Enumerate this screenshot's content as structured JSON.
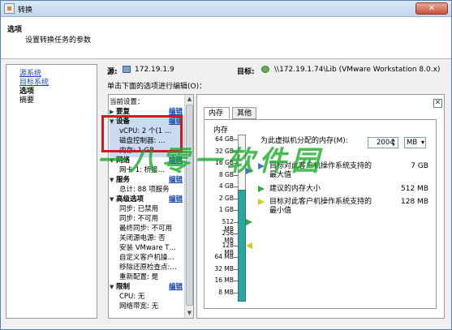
{
  "window": {
    "title": "转换",
    "close_glyph": "✕"
  },
  "header": {
    "title": "选项",
    "subtitle": "设置转换任务的参数"
  },
  "nav": {
    "items": [
      "源系统",
      "目标系统",
      "选项",
      "摘要"
    ]
  },
  "source": {
    "label": "源:",
    "value": "172.19.1.9"
  },
  "destination": {
    "label": "目标:",
    "value": "\\\\172.19.1.74\\Lib (VMware Workstation 8.0.x)"
  },
  "instruction": "单击下面的选项进行编辑(O)：",
  "settings": {
    "heading": "当前设置：",
    "edit_label": "编辑",
    "rows": [
      {
        "kind": "section",
        "text": "要复",
        "edit": true,
        "expanded": false
      },
      {
        "kind": "section",
        "text": "设备",
        "edit": true,
        "expanded": true
      },
      {
        "kind": "item",
        "text": "vCPU: 2 个(1 …"
      },
      {
        "kind": "item",
        "text": "磁盘控制器: …"
      },
      {
        "kind": "item",
        "text": "内存: 1 GB"
      },
      {
        "kind": "section",
        "text": "网络",
        "edit": true,
        "expanded": true
      },
      {
        "kind": "item",
        "text": "网卡 1: 桥接…"
      },
      {
        "kind": "section",
        "text": "服务",
        "edit": true,
        "expanded": true
      },
      {
        "kind": "item",
        "text": "总计: 88 项服务"
      },
      {
        "kind": "section",
        "text": "高级选项",
        "edit": true,
        "expanded": true
      },
      {
        "kind": "item",
        "text": "同步: 已禁用"
      },
      {
        "kind": "item",
        "text": "同步: 不可用"
      },
      {
        "kind": "item",
        "text": "最终同步: 不可用"
      },
      {
        "kind": "item",
        "text": "关闭源电源: 否"
      },
      {
        "kind": "item",
        "text": "安装 VMware T…"
      },
      {
        "kind": "item",
        "text": "自定义客户机操…"
      },
      {
        "kind": "item",
        "text": "移除还原检查点:…"
      },
      {
        "kind": "item",
        "text": "重新配置: 是"
      },
      {
        "kind": "section",
        "text": "限制",
        "edit": true,
        "expanded": true
      },
      {
        "kind": "item",
        "text": "CPU: 无"
      },
      {
        "kind": "item",
        "text": "网络带宽: 无"
      }
    ]
  },
  "tabs": [
    {
      "label": "内存",
      "active": true
    },
    {
      "label": "其他",
      "active": false
    }
  ],
  "memory": {
    "section_label": "内存",
    "question": "为此虚拟机分配的内存(M):",
    "value": "2004",
    "unit": "MB",
    "gauge_labels": [
      "64 GB",
      "32 GB",
      "16 GB",
      "8 GB",
      "4 GB",
      "2 GB",
      "1 GB",
      "512 MB",
      "256 MB",
      "128 MB",
      "64 MB",
      "32 MB",
      "16 MB",
      "8 MB"
    ],
    "legend": [
      {
        "icon": "blue-triangle-icon",
        "text": "目标对此客户机操作系统支持的最大值",
        "value": "7 GB"
      },
      {
        "icon": "green-triangle-icon",
        "text": "建议的内存大小",
        "value": "512 MB"
      },
      {
        "icon": "yellow-triangle-icon",
        "text": "目标对此客户机操作系统支持的最小值",
        "value": "128 MB"
      }
    ]
  },
  "watermark": "一八零一软件园",
  "colors": {
    "accent_link": "#1a4ab0",
    "gauge_fill": "#2aa6a0",
    "highlight_border": "#d8161b",
    "max_marker": "#3c79c8",
    "recommended_marker": "#2ea83c",
    "min_marker": "#e0c51f"
  }
}
